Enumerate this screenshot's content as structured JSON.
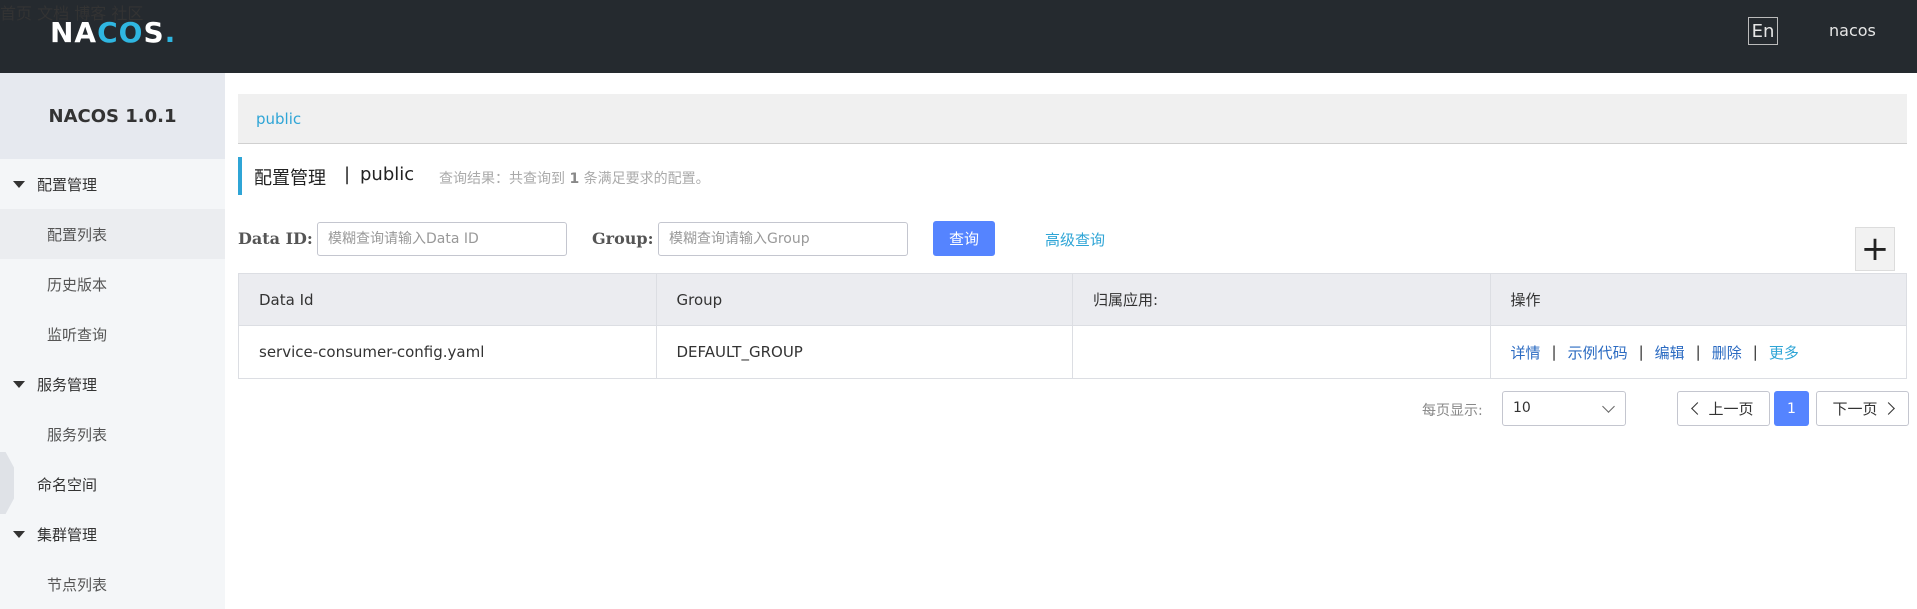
{
  "header": {
    "logo": {
      "a": "NA",
      "b": "CO",
      "c": "S",
      "d": "."
    },
    "nav": [
      "首页",
      "文档",
      "博客",
      "社区"
    ],
    "lang": "En",
    "user": "nacos"
  },
  "sidebar": {
    "brand": "NACOS 1.0.1",
    "groups": [
      {
        "label": "配置管理",
        "items": [
          "配置列表",
          "历史版本",
          "监听查询"
        ]
      },
      {
        "label": "服务管理",
        "items": [
          "服务列表"
        ]
      },
      {
        "label": "命名空间"
      },
      {
        "label": "集群管理",
        "items": [
          "节点列表"
        ]
      }
    ]
  },
  "main": {
    "namespace_tab": "public",
    "title": "配置管理",
    "title_sep": "|",
    "title_ns": "public",
    "result_prefix": "查询结果：共查询到 ",
    "result_count": "1",
    "result_suffix": " 条满足要求的配置。",
    "filters": {
      "dataid_label": "Data ID:",
      "dataid_placeholder": "模糊查询请输入Data ID",
      "group_label": "Group:",
      "group_placeholder": "模糊查询请输入Group",
      "query_button": "查询",
      "advanced_link": "高级查询",
      "add_symbol": "+"
    },
    "table": {
      "headers": [
        "Data Id",
        "Group",
        "归属应用:",
        "操作"
      ],
      "rows": [
        {
          "data_id": "service-consumer-config.yaml",
          "group": "DEFAULT_GROUP",
          "app": "",
          "ops": [
            "详情",
            "示例代码",
            "编辑",
            "删除",
            "更多"
          ]
        }
      ],
      "sep": "|"
    },
    "pagination": {
      "page_size_label": "每页显示:",
      "page_size": "10",
      "prev": "上一页",
      "current": "1",
      "next": "下一页"
    }
  }
}
